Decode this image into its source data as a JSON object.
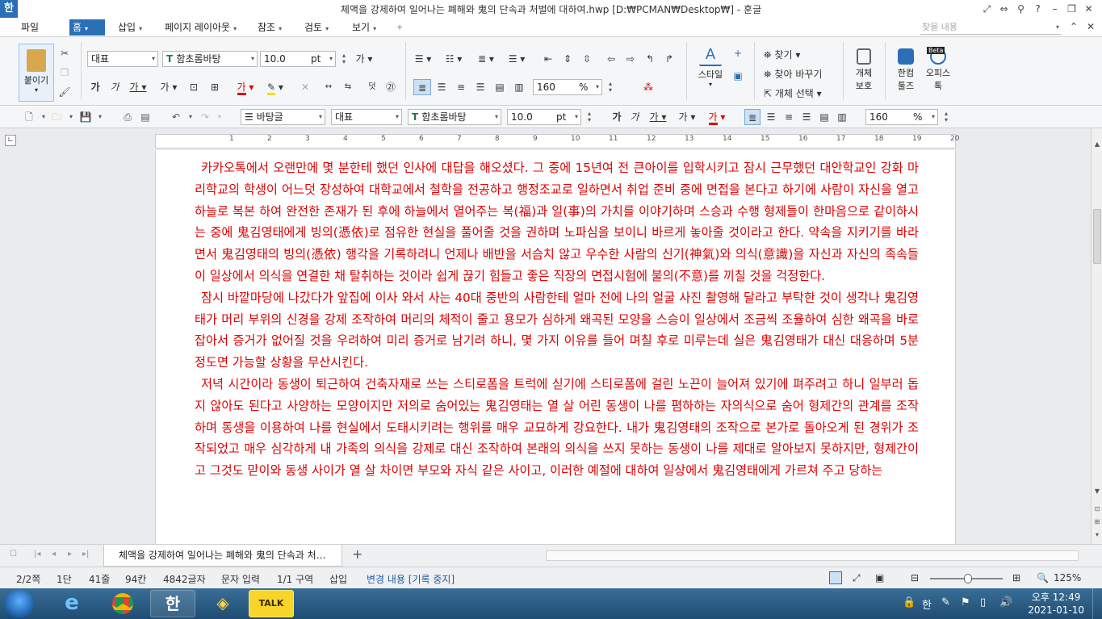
{
  "window": {
    "logo": "한",
    "title": "체액을 강제하여 일어나는 폐해와 鬼의 단속과 처벌에 대하여.hwp [D:₩PCMAN₩Desktop₩] - 훈글"
  },
  "menu": {
    "file": "파일",
    "items": [
      "홈",
      "삽입",
      "페이지 레이아웃",
      "참조",
      "검토",
      "보기"
    ],
    "search_placeholder": "찾을 내용"
  },
  "ribbon": {
    "paste": "붙이기",
    "style_combo": "대표",
    "font_combo": "함초롬바탕",
    "size_value": "10.0",
    "size_unit": "pt",
    "line_spacing_value": "160",
    "line_spacing_unit": "%",
    "find": "찾기",
    "find_replace": "찾아 바꾸기",
    "select_object": "개체 선택",
    "style_button": "스타일",
    "protect_line1": "개체",
    "protect_line2": "보호",
    "hancom_line1": "한컴",
    "hancom_line2": "툴즈",
    "office_line1": "오피스",
    "office_line2": "톡",
    "beta": "Beta"
  },
  "toolbar2": {
    "paragraph_style": "바탕글",
    "style_combo": "대표",
    "font_combo": "함초롬바탕",
    "size_value": "10.0",
    "size_unit": "pt",
    "line_spacing_value": "160",
    "line_spacing_unit": "%"
  },
  "ruler": {
    "numbers": [
      "1",
      "2",
      "3",
      "4",
      "5",
      "6",
      "7",
      "8",
      "9",
      "10",
      "11",
      "12",
      "13",
      "14",
      "15",
      "16",
      "17",
      "18",
      "19",
      "20"
    ]
  },
  "document": {
    "paragraphs": [
      "카카오톡에서 오랜만에 몇 분한테 했던 인사에 대답을 해오셨다. 그 중에 15년여 전 큰아이를 입학시키고 잠시 근무했던 대안학교인 강화 마리학교의 학생이 어느덧 장성하여 대학교에서 철학을 전공하고 행정조교로 일하면서 취업 준비 중에 면접을 본다고 하기에 사람이 자신을 열고 하늘로 복본 하여 완전한 존재가 된 후에 하늘에서 열어주는 복(福)과 일(事)의 가치를 이야기하며 스승과 수행 형제들이 한마음으로 같이하시는 중에 鬼김영태에게 빙의(憑依)로 점유한 현실을 풀어줄 것을 권하며 노파심을 보이니 바르게 놓아줄 것이라고 한다. 약속을 지키기를 바라면서 鬼김영태의 빙의(憑依) 행각을 기록하려니 언제나 배반을 서슴치 않고 우수한 사람의 신기(神氣)와 의식(意識)을 자신과 자신의 족속들이 일상에서 의식을 연결한 채 탈취하는 것이라 쉽게 끊기 힘들고 좋은 직장의 면접시험에 불의(不意)를 끼칠 것을 걱정한다.",
      "잠시 바깥마당에 나갔다가 앞집에 이사 와서 사는 40대 중반의 사람한테 얼마 전에 나의 얼굴 사진 촬영해 달라고 부탁한 것이 생각나 鬼김영태가 머리 부위의 신경을 강제 조작하여 머리의 체적이 줄고 용모가 심하게 왜곡된 모양을 스승이 일상에서 조금씩 조율하여 심한 왜곡을 바로잡아서 증거가 없어질 것을 우려하여 미리 증거로 남기려 하니, 몇 가지 이유를 들어 며칠 후로 미루는데 실은 鬼김영태가 대신 대응하며 5분 정도면 가능할 상황을 무산시킨다.",
      "저녁 시간이라 동생이 퇴근하여 건축자재로 쓰는 스티로폼을 트럭에 싣기에 스티로폼에 걸린 노끈이 늘어져 있기에 펴주려고 하니 일부러 돕지 않아도 된다고 사양하는 모양이지만 저의로 숨어있는 鬼김영태는 열 살 어린 동생이 나를 폄하하는 자의식으로 숨어 형제간의 관계를 조작하며 동생을 이용하여 나를 현실에서 도태시키려는 행위를 매우 교묘하게 강요한다. 내가 鬼김영태의 조작으로 본가로 돌아오게 된 경위가 조작되었고 매우 심각하게 내 가족의 의식을 강제로 대신 조작하여 본래의 의식을 쓰지 못하는 동생이 나를 제대로 알아보지 못하지만, 형제간이고 그것도 맏이와 동생 사이가 열 살 차이면 부모와 자식 같은 사이고, 이러한 예절에 대하여 일상에서 鬼김영태에게 가르쳐 주고 당하는"
    ]
  },
  "tabs": {
    "doc_tab": "체액을 강제하여 일어나는 폐해와 鬼의 단속과 처…",
    "add_tab": "+"
  },
  "status": {
    "page": "2/2쪽",
    "column": "1단",
    "line": "41줄",
    "col": "94칸",
    "chars": "4842글자",
    "input_mode": "문자 입력",
    "section": "1/1 구역",
    "insert": "삽입",
    "track_changes": "변경 내용 [기록 중지]",
    "zoom": "125%"
  },
  "taskbar": {
    "kakao": "TALK",
    "hangul_app": "한",
    "ime": "한",
    "time": "오후 12:49",
    "date": "2021-01-10"
  }
}
